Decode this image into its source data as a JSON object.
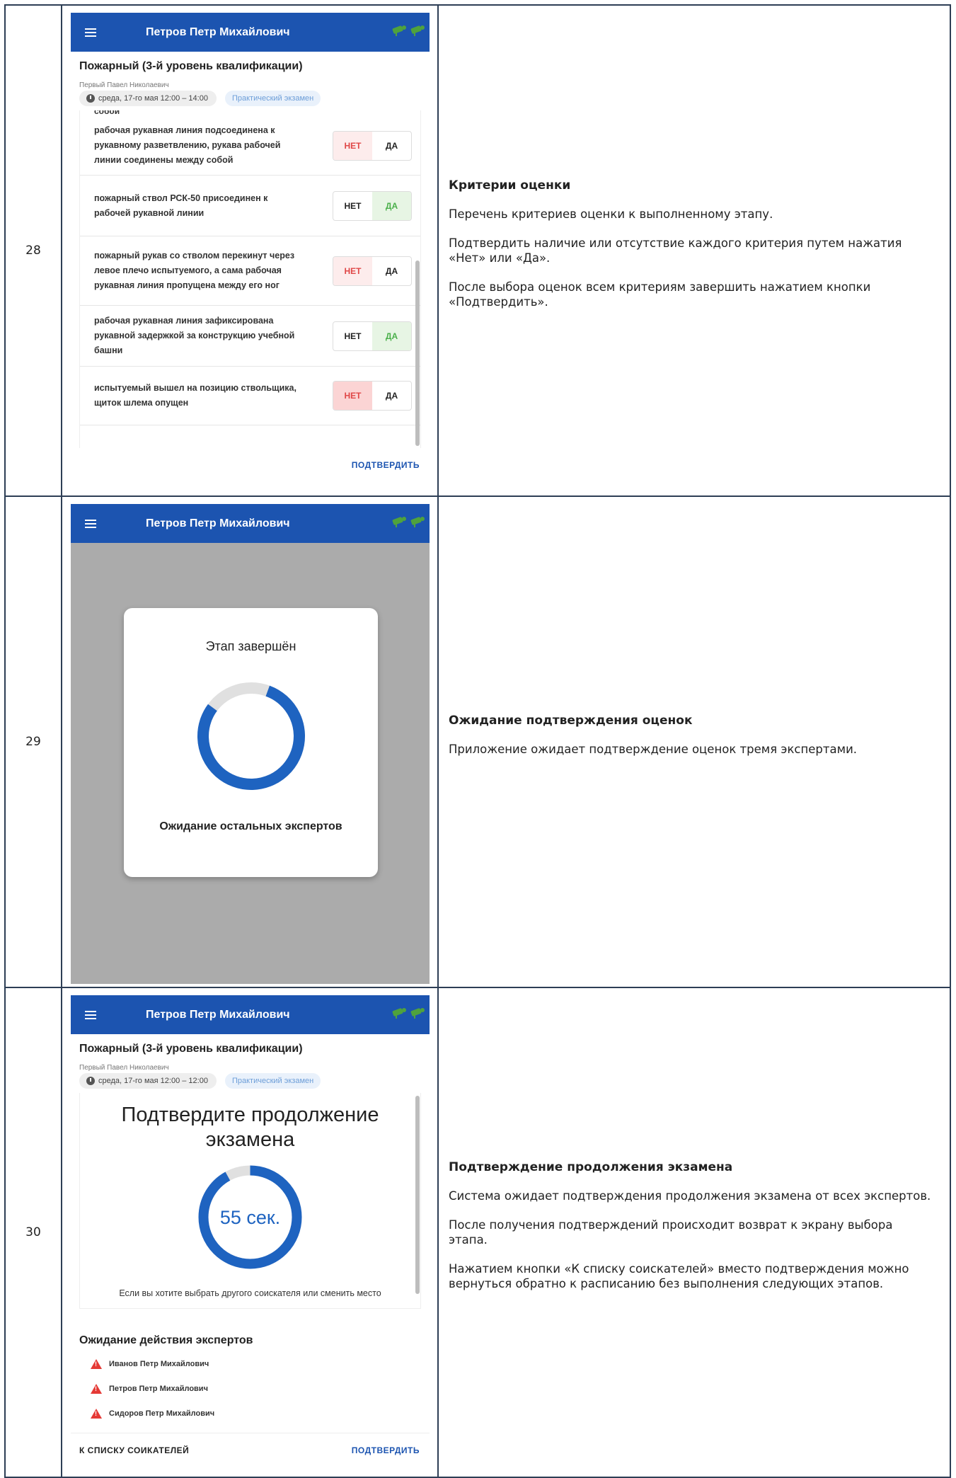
{
  "rows": [
    {
      "num": "28",
      "desc": {
        "title": "Критерии оценки",
        "p1": "Перечень критериев оценки к выполненному этапу.",
        "p2": "Подтвердить наличие или отсутствие каждого критерия путем нажатия «Нет» или «Да».",
        "p3": "После выбора оценок всем критериям завершить нажатием кнопки «Подтвердить»."
      },
      "app": {
        "user": "Петров Петр Михайлович",
        "exam_title": "Пожарный (3-й уровень квалификации)",
        "person": "Первый Павел Николаевич",
        "time": "среда, 17-го мая 12:00 – 14:00",
        "type": "Практический экзамен",
        "cut_text": "собой",
        "criteria": [
          {
            "text": "рабочая рукавная линия подсоединена к рукавному разветвлению, рукава рабочей линии соединены между собой",
            "no": "НЕТ",
            "yes": "ДА",
            "state": "no"
          },
          {
            "text": "пожарный ствол РСК-50 присоединен к рабочей рукавной линии",
            "no": "НЕТ",
            "yes": "ДА",
            "state": "yes"
          },
          {
            "text": "пожарный рукав со стволом перекинут через левое плечо испытуемого, а сама рабочая рукавная линия пропущена между его ног",
            "no": "НЕТ",
            "yes": "ДА",
            "state": "no"
          },
          {
            "text": "рабочая рукавная линия зафиксирована рукавной задержкой за конструкцию учебной башни",
            "no": "НЕТ",
            "yes": "ДА",
            "state": "yes"
          },
          {
            "text": "испытуемый вышел на позицию ствольщика, щиток шлема опущен",
            "no": "НЕТ",
            "yes": "ДА",
            "state": "no-strong"
          }
        ],
        "confirm": "ПОДТВЕРДИТЬ"
      }
    },
    {
      "num": "29",
      "desc": {
        "title": "Ожидание подтверждения оценок",
        "p1": "Приложение ожидает подтверждение оценок тремя экспертами."
      },
      "app": {
        "user": "Петров Петр Михайлович",
        "modal_title": "Этап завершён",
        "modal_sub": "Ожидание остальных экспертов"
      }
    },
    {
      "num": "30",
      "desc": {
        "title": "Подтверждение продолжения экзамена",
        "p1": "Система ожидает подтверждения продолжения экзамена от всех экспертов.",
        "p2": "После получения подтверждений происходит возврат к экрану выбора этапа.",
        "p3": "Нажатием кнопки «К списку соискателей» вместо подтверждения можно вернуться обратно к расписанию без выполнения следующих этапов."
      },
      "app": {
        "user": "Петров Петр Михайлович",
        "exam_title": "Пожарный (3-й уровень квалификации)",
        "person": "Первый Павел Николаевич",
        "time": "среда, 17-го мая 12:00 – 12:00",
        "type": "Практический экзамен",
        "confirm_title_1": "Подтвердите продолжение",
        "confirm_title_2": "экзамена",
        "countdown": "55 сек.",
        "countdown_fraction": 0.92,
        "note": "Если вы хотите выбрать другого соискателя или сменить место",
        "wait_head": "Ожидание действия экспертов",
        "experts": [
          "Иванов Петр Михайлович",
          "Петров Петр Михайлович",
          "Сидоров Петр Михайлович"
        ],
        "back": "К СПИСКУ СОИКАТЕЛЕЙ",
        "confirm": "ПОДТВЕРДИТЬ"
      }
    }
  ],
  "colors": {
    "appbar": "#1c54b0",
    "progress": "#1e63c0",
    "no": "#e04848",
    "yes": "#4bb04b"
  }
}
